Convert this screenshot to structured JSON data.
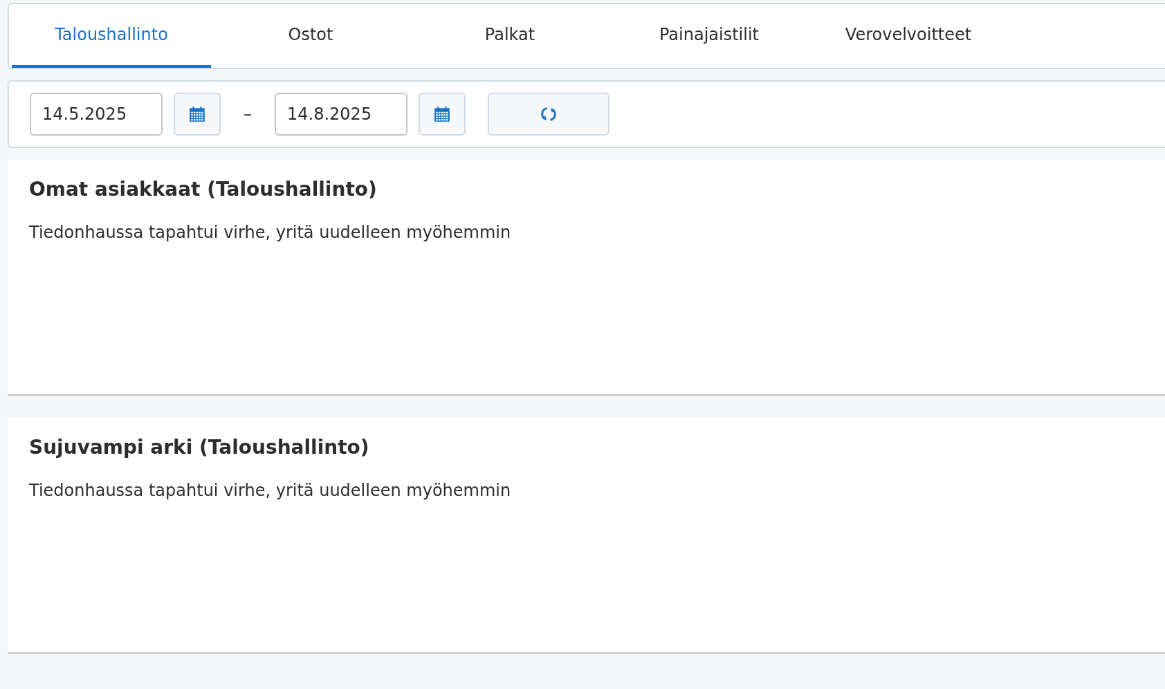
{
  "tabs": [
    {
      "label": "Taloushallinto",
      "selected": true
    },
    {
      "label": "Ostot",
      "selected": false
    },
    {
      "label": "Palkat",
      "selected": false
    },
    {
      "label": "Painajaistilit",
      "selected": false
    },
    {
      "label": "Verovelvoitteet",
      "selected": false
    }
  ],
  "date_range": {
    "start": "14.5.2025",
    "separator": "–",
    "end": "14.8.2025"
  },
  "sections": [
    {
      "title": "Omat asiakkaat (Taloushallinto)",
      "message": "Tiedonhaussa tapahtui virhe, yritä uudelleen myöhemmin"
    },
    {
      "title": "Sujuvampi arki (Taloushallinto)",
      "message": "Tiedonhaussa tapahtui virhe, yritä uudelleen myöhemmin"
    }
  ]
}
